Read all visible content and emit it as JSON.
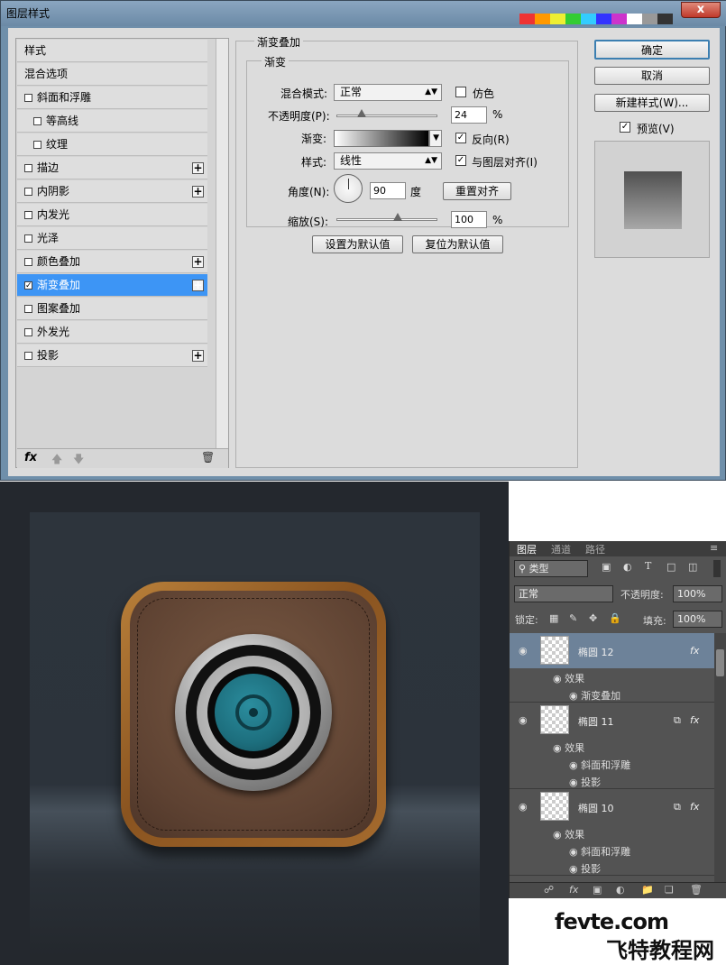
{
  "dialog": {
    "title": "图层样式",
    "close_label": "x",
    "styles_list": [
      {
        "label": "样式",
        "type": "plain",
        "checked": false,
        "plus": false,
        "selected": false
      },
      {
        "label": "混合选项",
        "type": "plain",
        "checked": false,
        "plus": false,
        "selected": false
      },
      {
        "label": "斜面和浮雕",
        "type": "check",
        "checked": false,
        "plus": false,
        "selected": false
      },
      {
        "label": "等高线",
        "type": "sub",
        "checked": false,
        "plus": false,
        "selected": false
      },
      {
        "label": "纹理",
        "type": "sub",
        "checked": false,
        "plus": false,
        "selected": false
      },
      {
        "label": "描边",
        "type": "check",
        "checked": false,
        "plus": true,
        "selected": false
      },
      {
        "label": "内阴影",
        "type": "check",
        "checked": false,
        "plus": true,
        "selected": false
      },
      {
        "label": "内发光",
        "type": "check",
        "checked": false,
        "plus": false,
        "selected": false
      },
      {
        "label": "光泽",
        "type": "check",
        "checked": false,
        "plus": false,
        "selected": false
      },
      {
        "label": "颜色叠加",
        "type": "check",
        "checked": false,
        "plus": true,
        "selected": false
      },
      {
        "label": "渐变叠加",
        "type": "check",
        "checked": true,
        "plus": true,
        "selected": true
      },
      {
        "label": "图案叠加",
        "type": "check",
        "checked": false,
        "plus": false,
        "selected": false
      },
      {
        "label": "外发光",
        "type": "check",
        "checked": false,
        "plus": false,
        "selected": false
      },
      {
        "label": "投影",
        "type": "check",
        "checked": false,
        "plus": true,
        "selected": false
      }
    ],
    "list_footer": {
      "fx": "fx",
      "up_icon": "arrow-up-icon",
      "down_icon": "arrow-down-icon",
      "trash_icon": "trash-icon"
    },
    "gradient_overlay": {
      "section_title": "渐变叠加",
      "group_title": "渐变",
      "blend_mode_label": "混合模式:",
      "blend_mode_value": "正常",
      "dither_label": "仿色",
      "dither_checked": false,
      "opacity_label": "不透明度(P):",
      "opacity_value": "24",
      "opacity_fraction": 0.24,
      "opacity_unit": "%",
      "gradient_label": "渐变:",
      "reverse_label": "反向(R)",
      "reverse_checked": true,
      "style_label": "样式:",
      "style_value": "线性",
      "align_label": "与图层对齐(I)",
      "align_checked": true,
      "angle_label": "角度(N):",
      "angle_value": "90",
      "angle_unit": "度",
      "reset_align_label": "重置对齐",
      "scale_label": "缩放(S):",
      "scale_value": "100",
      "scale_fraction": 0.6,
      "scale_unit": "%",
      "set_default_label": "设置为默认值",
      "reset_default_label": "复位为默认值"
    },
    "buttons": {
      "ok": "确定",
      "cancel": "取消",
      "new_style": "新建样式(W)..."
    },
    "preview_label": "预览(V)",
    "preview_checked": true
  },
  "layers_panel": {
    "tabs": [
      "图层",
      "通道",
      "路径"
    ],
    "filter_label": "类型",
    "blend_mode": "正常",
    "opacity_label": "不透明度:",
    "opacity_value": "100%",
    "lock_label": "锁定:",
    "fill_label": "填充:",
    "fill_value": "100%",
    "layers": [
      {
        "name": "椭圆 12",
        "selected": true,
        "effects_label": "效果",
        "effects": [
          "渐变叠加"
        ]
      },
      {
        "name": "椭圆 11",
        "selected": false,
        "effects_label": "效果",
        "effects": [
          "斜面和浮雕",
          "投影"
        ]
      },
      {
        "name": "椭圆 10",
        "selected": false,
        "effects_label": "效果",
        "effects": [
          "斜面和浮雕",
          "投影"
        ]
      }
    ]
  },
  "watermark": {
    "site": "fevte.com",
    "cn": "飞特教程网"
  },
  "colors": {
    "selected_row": "#3d95f5",
    "dialog_bg": "#dcdcdc",
    "panel_bg": "#535353",
    "lens": "#1d6f7e",
    "wood": "#a46a2d",
    "leather": "#5e4232"
  }
}
